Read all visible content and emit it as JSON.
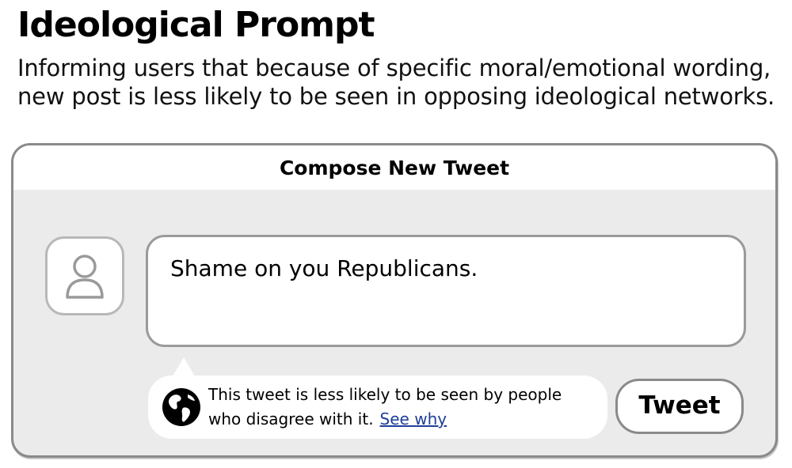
{
  "heading": {
    "title": "Ideological Prompt",
    "description": "Informing users that because of specific moral/emotional wording, new post is less likely to be seen in opposing ideological networks."
  },
  "compose": {
    "window_title": "Compose New Tweet",
    "tweet_text": "Shame on you Republicans.",
    "notice": {
      "line1": "This tweet is less likely to be seen by people",
      "line2": "who disagree with it.",
      "link_label": "See why",
      "icon": "globe-icon"
    },
    "tweet_button_label": "Tweet",
    "avatar_icon": "user-icon"
  },
  "colors": {
    "window_background": "#ebebeb",
    "window_border": "#8a8a8a",
    "link": "#1f3f9a",
    "globe": "#000000"
  }
}
